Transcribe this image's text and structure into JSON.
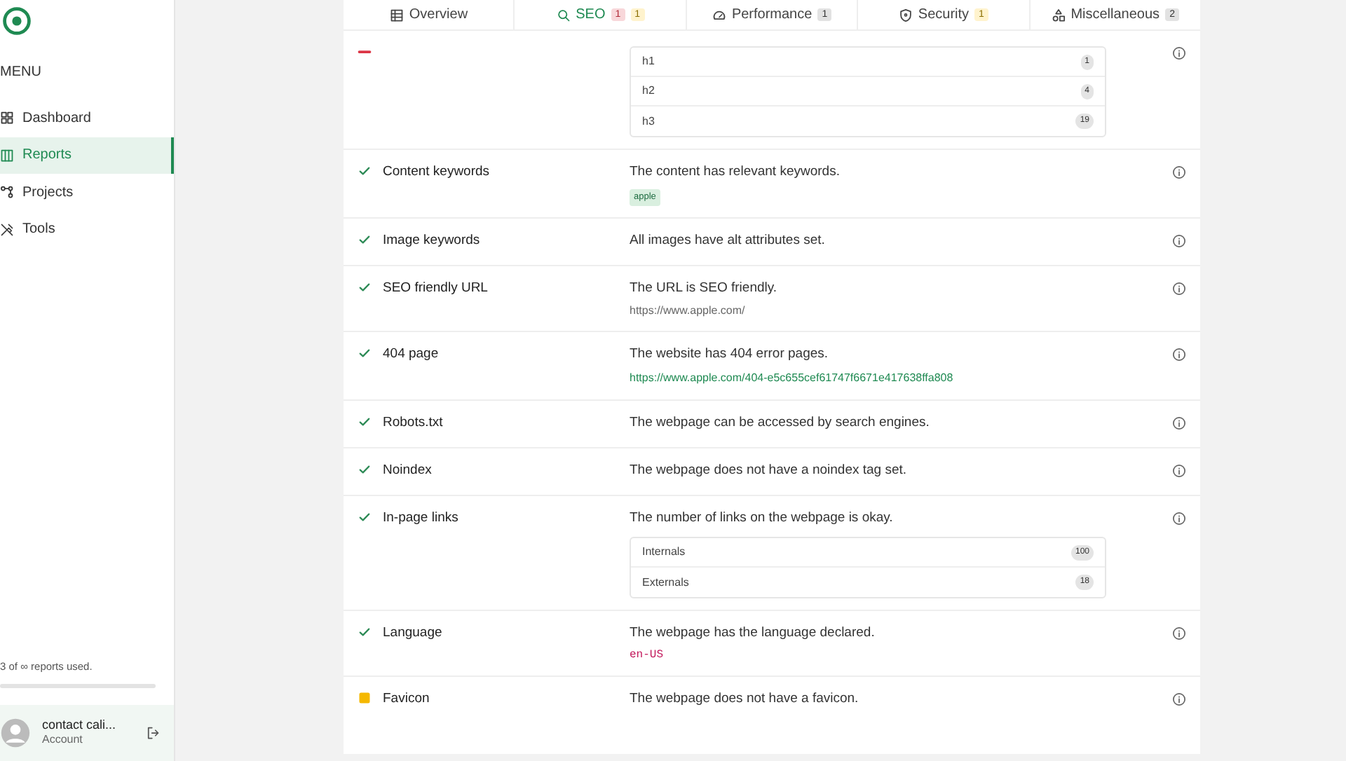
{
  "sidebar": {
    "menu_title": "MENU",
    "items": [
      {
        "label": "Dashboard",
        "selected": false
      },
      {
        "label": "Reports",
        "selected": true
      },
      {
        "label": "Projects",
        "selected": false
      },
      {
        "label": "Tools",
        "selected": false
      }
    ],
    "usage": "3 of ∞ reports used.",
    "account": {
      "name": "contact cali...",
      "role": "Account"
    }
  },
  "tabs": [
    {
      "label": "Overview",
      "selected": false
    },
    {
      "label": "SEO",
      "selected": true,
      "badges": [
        {
          "text": "1",
          "kind": "danger"
        },
        {
          "text": "1",
          "kind": "warning"
        }
      ]
    },
    {
      "label": "Performance",
      "selected": false,
      "badges": [
        {
          "text": "1",
          "kind": "neutral"
        }
      ]
    },
    {
      "label": "Security",
      "selected": false,
      "badges": [
        {
          "text": "1",
          "kind": "warning"
        }
      ]
    },
    {
      "label": "Miscellaneous",
      "selected": false,
      "badges": [
        {
          "text": "2",
          "kind": "neutral"
        }
      ]
    }
  ],
  "checks": [
    {
      "kind": "error",
      "details": [
        {
          "kind": "list",
          "items": [
            {
              "label": "h1",
              "count": "1"
            },
            {
              "label": "h2",
              "count": "4"
            },
            {
              "label": "h3",
              "count": "19"
            }
          ]
        }
      ]
    },
    {
      "kind": "pass",
      "label": "Content keywords",
      "message": "The content has relevant keywords.",
      "details": [
        {
          "kind": "tag",
          "text": "apple"
        }
      ]
    },
    {
      "kind": "pass",
      "label": "Image keywords",
      "message": "All images have alt attributes set."
    },
    {
      "kind": "pass",
      "label": "SEO friendly URL",
      "message": "The URL is SEO friendly.",
      "details": [
        {
          "kind": "url",
          "text": "https://www.apple.com/"
        }
      ]
    },
    {
      "kind": "pass",
      "label": "404 page",
      "message": "The website has 404 error pages.",
      "details": [
        {
          "kind": "link",
          "text": "https://www.apple.com/404-e5c655cef61747f6671e417638ffa808"
        }
      ]
    },
    {
      "kind": "pass",
      "label": "Robots.txt",
      "message": "The webpage can be accessed by search engines."
    },
    {
      "kind": "pass",
      "label": "Noindex",
      "message": "The webpage does not have a noindex tag set."
    },
    {
      "kind": "pass",
      "label": "In-page links",
      "message": "The number of links on the webpage is okay.",
      "details": [
        {
          "kind": "list",
          "items": [
            {
              "label": "Internals",
              "count": "100"
            },
            {
              "label": "Externals",
              "count": "18"
            }
          ]
        }
      ]
    },
    {
      "kind": "pass",
      "label": "Language",
      "message": "The webpage has the language declared.",
      "details": [
        {
          "kind": "code",
          "text": "en-US"
        }
      ]
    },
    {
      "kind": "warning",
      "label": "Favicon",
      "message": "The webpage does not have a favicon."
    }
  ]
}
